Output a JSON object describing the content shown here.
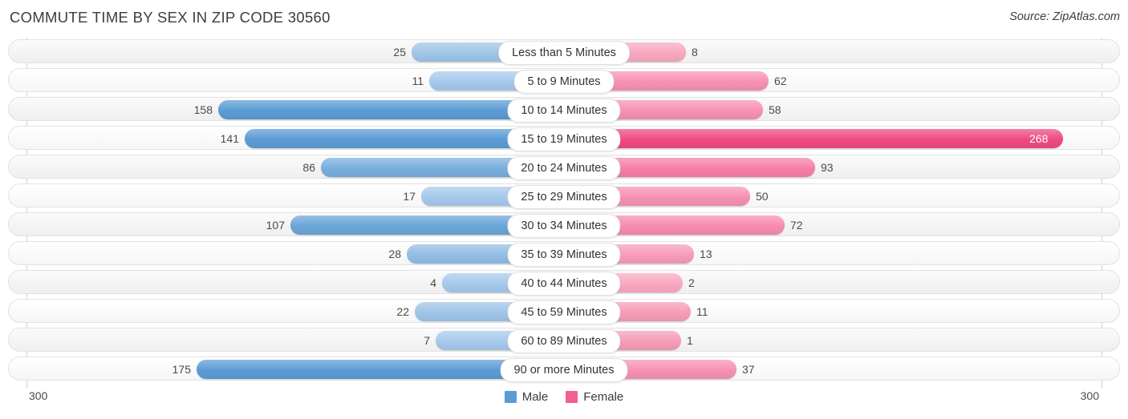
{
  "header": {
    "title": "COMMUTE TIME BY SEX IN ZIP CODE 30560",
    "source": "Source: ZipAtlas.com"
  },
  "legend": {
    "male_label": "Male",
    "female_label": "Female",
    "male_color": "#5b9bd5",
    "female_color": "#f2608f"
  },
  "axis": {
    "left_tick": "300",
    "right_tick": "300"
  },
  "chart_data": {
    "type": "bar",
    "orientation": "horizontal-diverging",
    "title": "COMMUTE TIME BY SEX IN ZIP CODE 30560",
    "xlabel": "",
    "ylabel": "",
    "xlim": [
      -300,
      300
    ],
    "grid": false,
    "legend_position": "bottom-center",
    "categories": [
      "Less than 5 Minutes",
      "5 to 9 Minutes",
      "10 to 14 Minutes",
      "15 to 19 Minutes",
      "20 to 24 Minutes",
      "25 to 29 Minutes",
      "30 to 34 Minutes",
      "35 to 39 Minutes",
      "40 to 44 Minutes",
      "45 to 59 Minutes",
      "60 to 89 Minutes",
      "90 or more Minutes"
    ],
    "series": [
      {
        "name": "Male",
        "values": [
          25,
          11,
          158,
          141,
          86,
          17,
          107,
          28,
          4,
          22,
          7,
          175
        ]
      },
      {
        "name": "Female",
        "values": [
          8,
          62,
          58,
          268,
          93,
          50,
          72,
          13,
          2,
          11,
          1,
          37
        ]
      }
    ]
  },
  "rows": [
    {
      "category": "Less than 5 Minutes",
      "male": "25",
      "female": "8",
      "male_color": "#9fc5e8",
      "female_color": "#f9a8c0",
      "male_w": 190,
      "female_w": 152,
      "female_inside": false
    },
    {
      "category": "5 to 9 Minutes",
      "male": "11",
      "female": "62",
      "male_color": "#a6c9ec",
      "female_color": "#f791b2",
      "male_w": 168,
      "female_w": 255,
      "female_inside": false
    },
    {
      "category": "10 to 14 Minutes",
      "male": "158",
      "female": "58",
      "male_color": "#5b9bd5",
      "female_color": "#f791b2",
      "male_w": 431,
      "female_w": 248,
      "female_inside": false
    },
    {
      "category": "15 to 19 Minutes",
      "male": "141",
      "female": "268",
      "male_color": "#5b9bd5",
      "female_color": "#ef4a80",
      "male_w": 398,
      "female_w": 622,
      "female_inside": true
    },
    {
      "category": "20 to 24 Minutes",
      "male": "86",
      "female": "93",
      "male_color": "#79afdd",
      "female_color": "#f77fa6",
      "male_w": 303,
      "female_w": 313,
      "female_inside": false
    },
    {
      "category": "25 to 29 Minutes",
      "male": "17",
      "female": "50",
      "male_color": "#a6c9ec",
      "female_color": "#f791b2",
      "male_w": 178,
      "female_w": 232,
      "female_inside": false
    },
    {
      "category": "30 to 34 Minutes",
      "male": "107",
      "female": "72",
      "male_color": "#6ba5d9",
      "female_color": "#f78bae",
      "male_w": 341,
      "female_w": 275,
      "female_inside": false
    },
    {
      "category": "35 to 39 Minutes",
      "male": "28",
      "female": "13",
      "male_color": "#92bde6",
      "female_color": "#f79cb8",
      "male_w": 196,
      "female_w": 162,
      "female_inside": false
    },
    {
      "category": "40 to 44 Minutes",
      "male": "4",
      "female": "2",
      "male_color": "#a6c9ec",
      "female_color": "#f9a8c0",
      "male_w": 152,
      "female_w": 148,
      "female_inside": false
    },
    {
      "category": "45 to 59 Minutes",
      "male": "22",
      "female": "11",
      "male_color": "#9fc5e8",
      "female_color": "#f79cb8",
      "male_w": 186,
      "female_w": 158,
      "female_inside": false
    },
    {
      "category": "60 to 89 Minutes",
      "male": "7",
      "female": "1",
      "male_color": "#a6c9ec",
      "female_color": "#f79cb8",
      "male_w": 160,
      "female_w": 146,
      "female_inside": false
    },
    {
      "category": "90 or more Minutes",
      "male": "175",
      "female": "37",
      "male_color": "#5b9bd5",
      "female_color": "#f791b2",
      "male_w": 458,
      "female_w": 215,
      "female_inside": false
    }
  ]
}
